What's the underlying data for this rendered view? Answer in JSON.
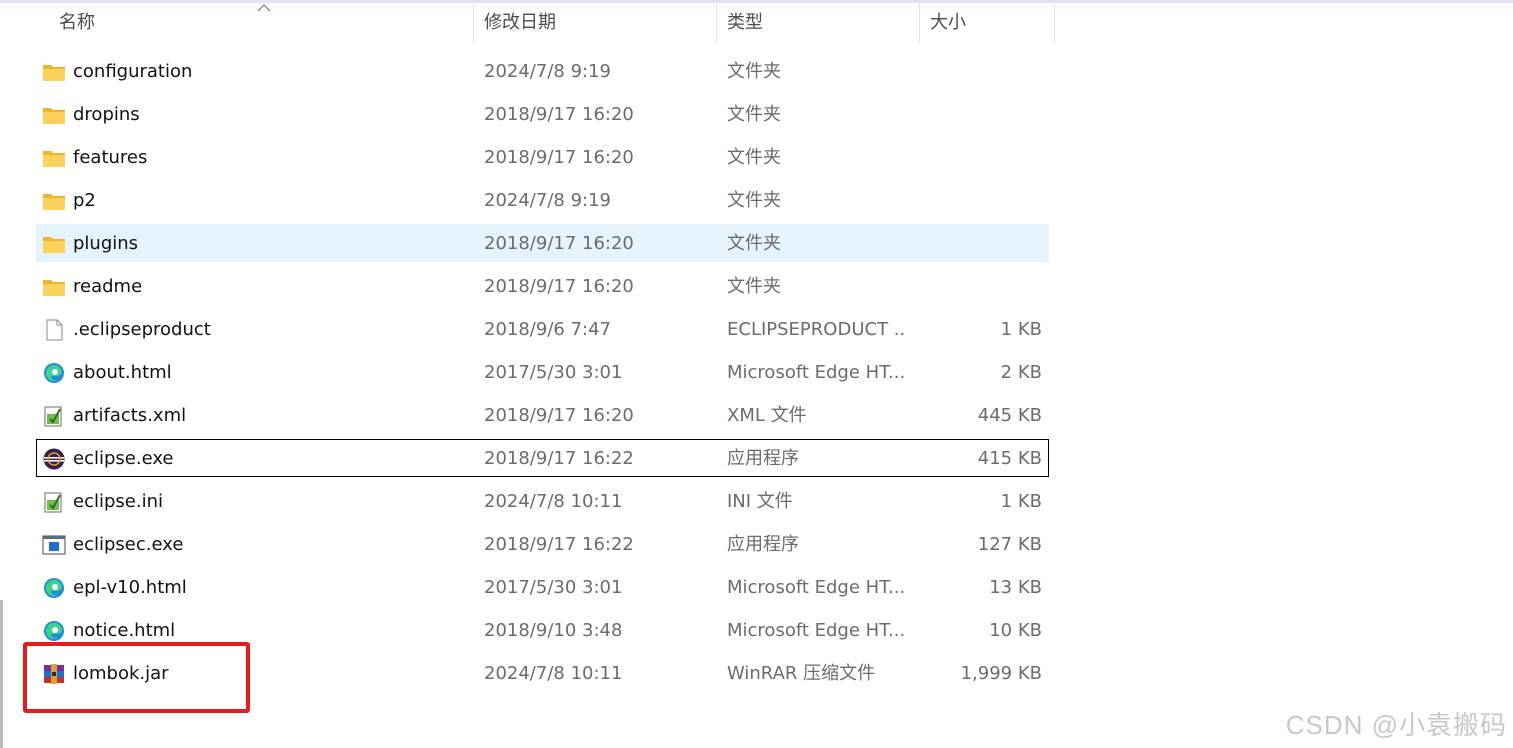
{
  "columns": {
    "name": "名称",
    "date": "修改日期",
    "type": "类型",
    "size": "大小"
  },
  "files": [
    {
      "name": "configuration",
      "date": "2024/7/8 9:19",
      "type": "文件夹",
      "size": "",
      "icon": "folder-icon"
    },
    {
      "name": "dropins",
      "date": "2018/9/17 16:20",
      "type": "文件夹",
      "size": "",
      "icon": "folder-icon"
    },
    {
      "name": "features",
      "date": "2018/9/17 16:20",
      "type": "文件夹",
      "size": "",
      "icon": "folder-icon"
    },
    {
      "name": "p2",
      "date": "2024/7/8 9:19",
      "type": "文件夹",
      "size": "",
      "icon": "folder-icon"
    },
    {
      "name": "plugins",
      "date": "2018/9/17 16:20",
      "type": "文件夹",
      "size": "",
      "icon": "folder-icon"
    },
    {
      "name": "readme",
      "date": "2018/9/17 16:20",
      "type": "文件夹",
      "size": "",
      "icon": "folder-icon"
    },
    {
      "name": ".eclipseproduct",
      "date": "2018/9/6 7:47",
      "type": "ECLIPSEPRODUCT ...",
      "size": "1 KB",
      "icon": "blank-file-icon"
    },
    {
      "name": "about.html",
      "date": "2017/5/30 3:01",
      "type": "Microsoft Edge HT...",
      "size": "2 KB",
      "icon": "edge-icon"
    },
    {
      "name": "artifacts.xml",
      "date": "2018/9/17 16:20",
      "type": "XML 文件",
      "size": "445 KB",
      "icon": "notepad-file-icon"
    },
    {
      "name": "eclipse.exe",
      "date": "2018/9/17 16:22",
      "type": "应用程序",
      "size": "415 KB",
      "icon": "eclipse-icon"
    },
    {
      "name": "eclipse.ini",
      "date": "2024/7/8 10:11",
      "type": "INI 文件",
      "size": "1 KB",
      "icon": "notepad-file-icon"
    },
    {
      "name": "eclipsec.exe",
      "date": "2018/9/17 16:22",
      "type": "应用程序",
      "size": "127 KB",
      "icon": "app-window-icon"
    },
    {
      "name": "epl-v10.html",
      "date": "2017/5/30 3:01",
      "type": "Microsoft Edge HT...",
      "size": "13 KB",
      "icon": "edge-icon"
    },
    {
      "name": "notice.html",
      "date": "2018/9/10 3:48",
      "type": "Microsoft Edge HT...",
      "size": "10 KB",
      "icon": "edge-icon"
    },
    {
      "name": "lombok.jar",
      "date": "2024/7/8 10:11",
      "type": "WinRAR 压缩文件",
      "size": "1,999 KB",
      "icon": "winrar-archive-icon"
    }
  ],
  "hovered_row": "plugins",
  "focused_row": "eclipse.exe",
  "watermark": "CSDN @小袁搬码",
  "colors": {
    "hover": "#e5f3ff",
    "highlight_box": "#e8191f",
    "folder": "#f8c94a"
  }
}
